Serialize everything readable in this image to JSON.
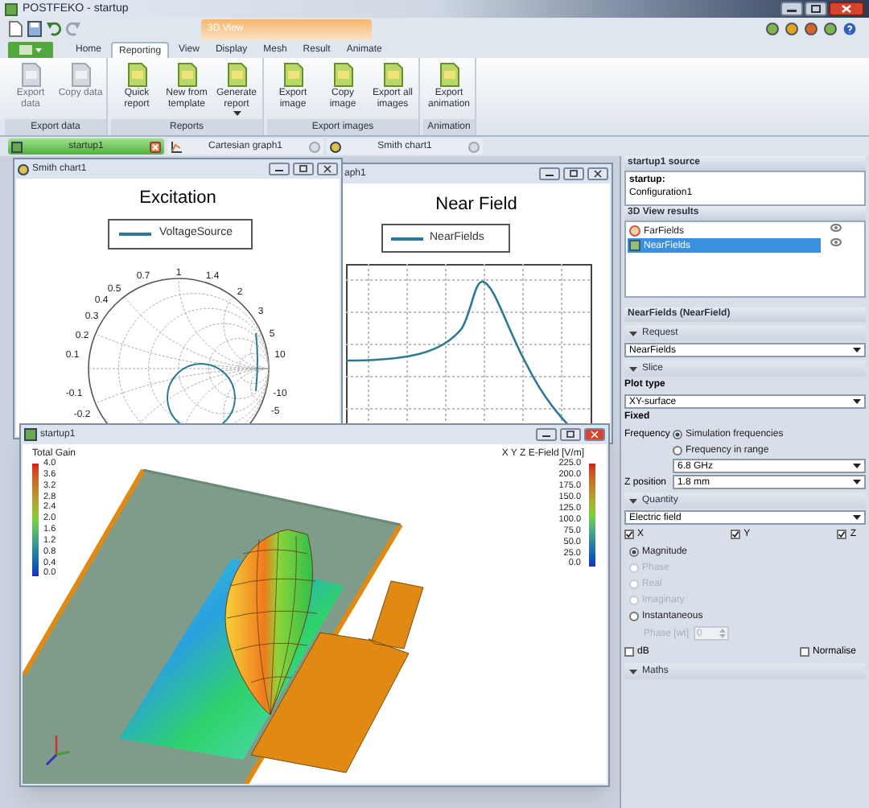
{
  "window": {
    "title": "POSTFEKO - startup",
    "contextual_tab": "3D View"
  },
  "ribbon_tabs": [
    {
      "label": "Home",
      "selected": false
    },
    {
      "label": "Reporting",
      "selected": true
    },
    {
      "label": "View",
      "selected": false
    },
    {
      "label": "Display",
      "selected": false
    },
    {
      "label": "Mesh",
      "selected": false
    },
    {
      "label": "Result",
      "selected": false
    },
    {
      "label": "Animate",
      "selected": false
    }
  ],
  "ribbon_groups": [
    {
      "label": "Export data",
      "buttons": [
        {
          "label": "Export data",
          "disabled": true,
          "menu": false
        },
        {
          "label": "Copy data",
          "disabled": true,
          "menu": false
        }
      ]
    },
    {
      "label": "Reports",
      "buttons": [
        {
          "label": "Quick report",
          "disabled": false,
          "menu": false
        },
        {
          "label": "New from template",
          "disabled": false,
          "menu": false
        },
        {
          "label": "Generate report",
          "disabled": false,
          "menu": true
        }
      ]
    },
    {
      "label": "Export images",
      "buttons": [
        {
          "label": "Export image",
          "disabled": false,
          "menu": false
        },
        {
          "label": "Copy image",
          "disabled": false,
          "menu": false
        },
        {
          "label": "Export all images",
          "disabled": false,
          "menu": false
        }
      ]
    },
    {
      "label": "Animation",
      "buttons": [
        {
          "label": "Export animation",
          "disabled": false,
          "menu": false
        }
      ]
    }
  ],
  "document_tabs": [
    {
      "label": "startup1",
      "selected": true
    },
    {
      "label": "Cartesian graph1",
      "selected": false
    },
    {
      "label": "Smith chart1",
      "selected": false
    }
  ],
  "smith_window": {
    "title": "Smith chart1",
    "chart_title": "Excitation",
    "legend": "VoltageSource",
    "labels": [
      "0.7",
      "1",
      "1.4",
      "0.5",
      "2",
      "0.4",
      "0.3",
      "3",
      "0.2",
      "5",
      "0.1",
      "10",
      "-0.1",
      "-10",
      "-0.2",
      "-5"
    ]
  },
  "graph_window": {
    "title": "aph1",
    "chart_title": "Near Field",
    "legend": "NearFields"
  },
  "view_window": {
    "title": "startup1",
    "gain_legend": {
      "title": "Total Gain",
      "ticks": [
        "4.0",
        "3.6",
        "3.2",
        "2.8",
        "2.4",
        "2.0",
        "1.6",
        "1.2",
        "0.8",
        "0.4",
        "0.0"
      ]
    },
    "field_legend": {
      "title": "X Y Z E-Field [V/m]",
      "ticks": [
        "225.0",
        "200.0",
        "175.0",
        "150.0",
        "125.0",
        "100.0",
        "75.0",
        "50.0",
        "25.0",
        "0.0"
      ]
    }
  },
  "side_panel": {
    "source": {
      "header": "startup1 source",
      "name": "startup:",
      "config": "Configuration1"
    },
    "results": {
      "header": "3D View results",
      "items": [
        {
          "label": "FarFields",
          "selected": false
        },
        {
          "label": "NearFields",
          "selected": true
        }
      ]
    },
    "properties": {
      "header": "NearFields (NearField)",
      "rows": [
        {
          "kind": "section",
          "label": "Request"
        },
        {
          "kind": "dropdown",
          "value": "NearFields"
        },
        {
          "kind": "section",
          "label": "Slice"
        },
        {
          "kind": "heading",
          "label": "Plot type"
        },
        {
          "kind": "dropdown",
          "value": "XY-surface"
        },
        {
          "kind": "heading",
          "label": "Fixed"
        },
        {
          "kind": "radio",
          "field_label": "Frequency",
          "label": "Simulation frequencies",
          "selected": true,
          "disabled": false
        },
        {
          "kind": "radio",
          "label": "Frequency in range",
          "selected": false,
          "disabled": false
        },
        {
          "kind": "subdropdown",
          "value": "6.8 GHz"
        },
        {
          "kind": "labeled_dropdown",
          "label": "Z position",
          "value": "1.8 mm"
        },
        {
          "kind": "section",
          "label": "Quantity"
        },
        {
          "kind": "dropdown",
          "value": "Electric field"
        },
        {
          "kind": "checks",
          "items": [
            {
              "label": "X",
              "checked": true
            },
            {
              "label": "Y",
              "checked": true
            },
            {
              "label": "Z",
              "checked": true
            }
          ]
        },
        {
          "kind": "radio",
          "label": "Magnitude",
          "selected": true,
          "disabled": false
        },
        {
          "kind": "radio",
          "label": "Phase",
          "selected": false,
          "disabled": true
        },
        {
          "kind": "radio",
          "label": "Real",
          "selected": false,
          "disabled": true
        },
        {
          "kind": "radio",
          "label": "Imaginary",
          "selected": false,
          "disabled": true
        },
        {
          "kind": "radio",
          "label": "Instantaneous",
          "selected": false,
          "disabled": false
        },
        {
          "kind": "spinner",
          "label": "Phase [wt]",
          "value": "0",
          "disabled": true
        },
        {
          "kind": "checks",
          "items": [
            {
              "label": "dB",
              "checked": false
            },
            {
              "label": "Normalise",
              "checked": false
            }
          ]
        },
        {
          "kind": "section",
          "label": "Maths"
        }
      ]
    }
  }
}
